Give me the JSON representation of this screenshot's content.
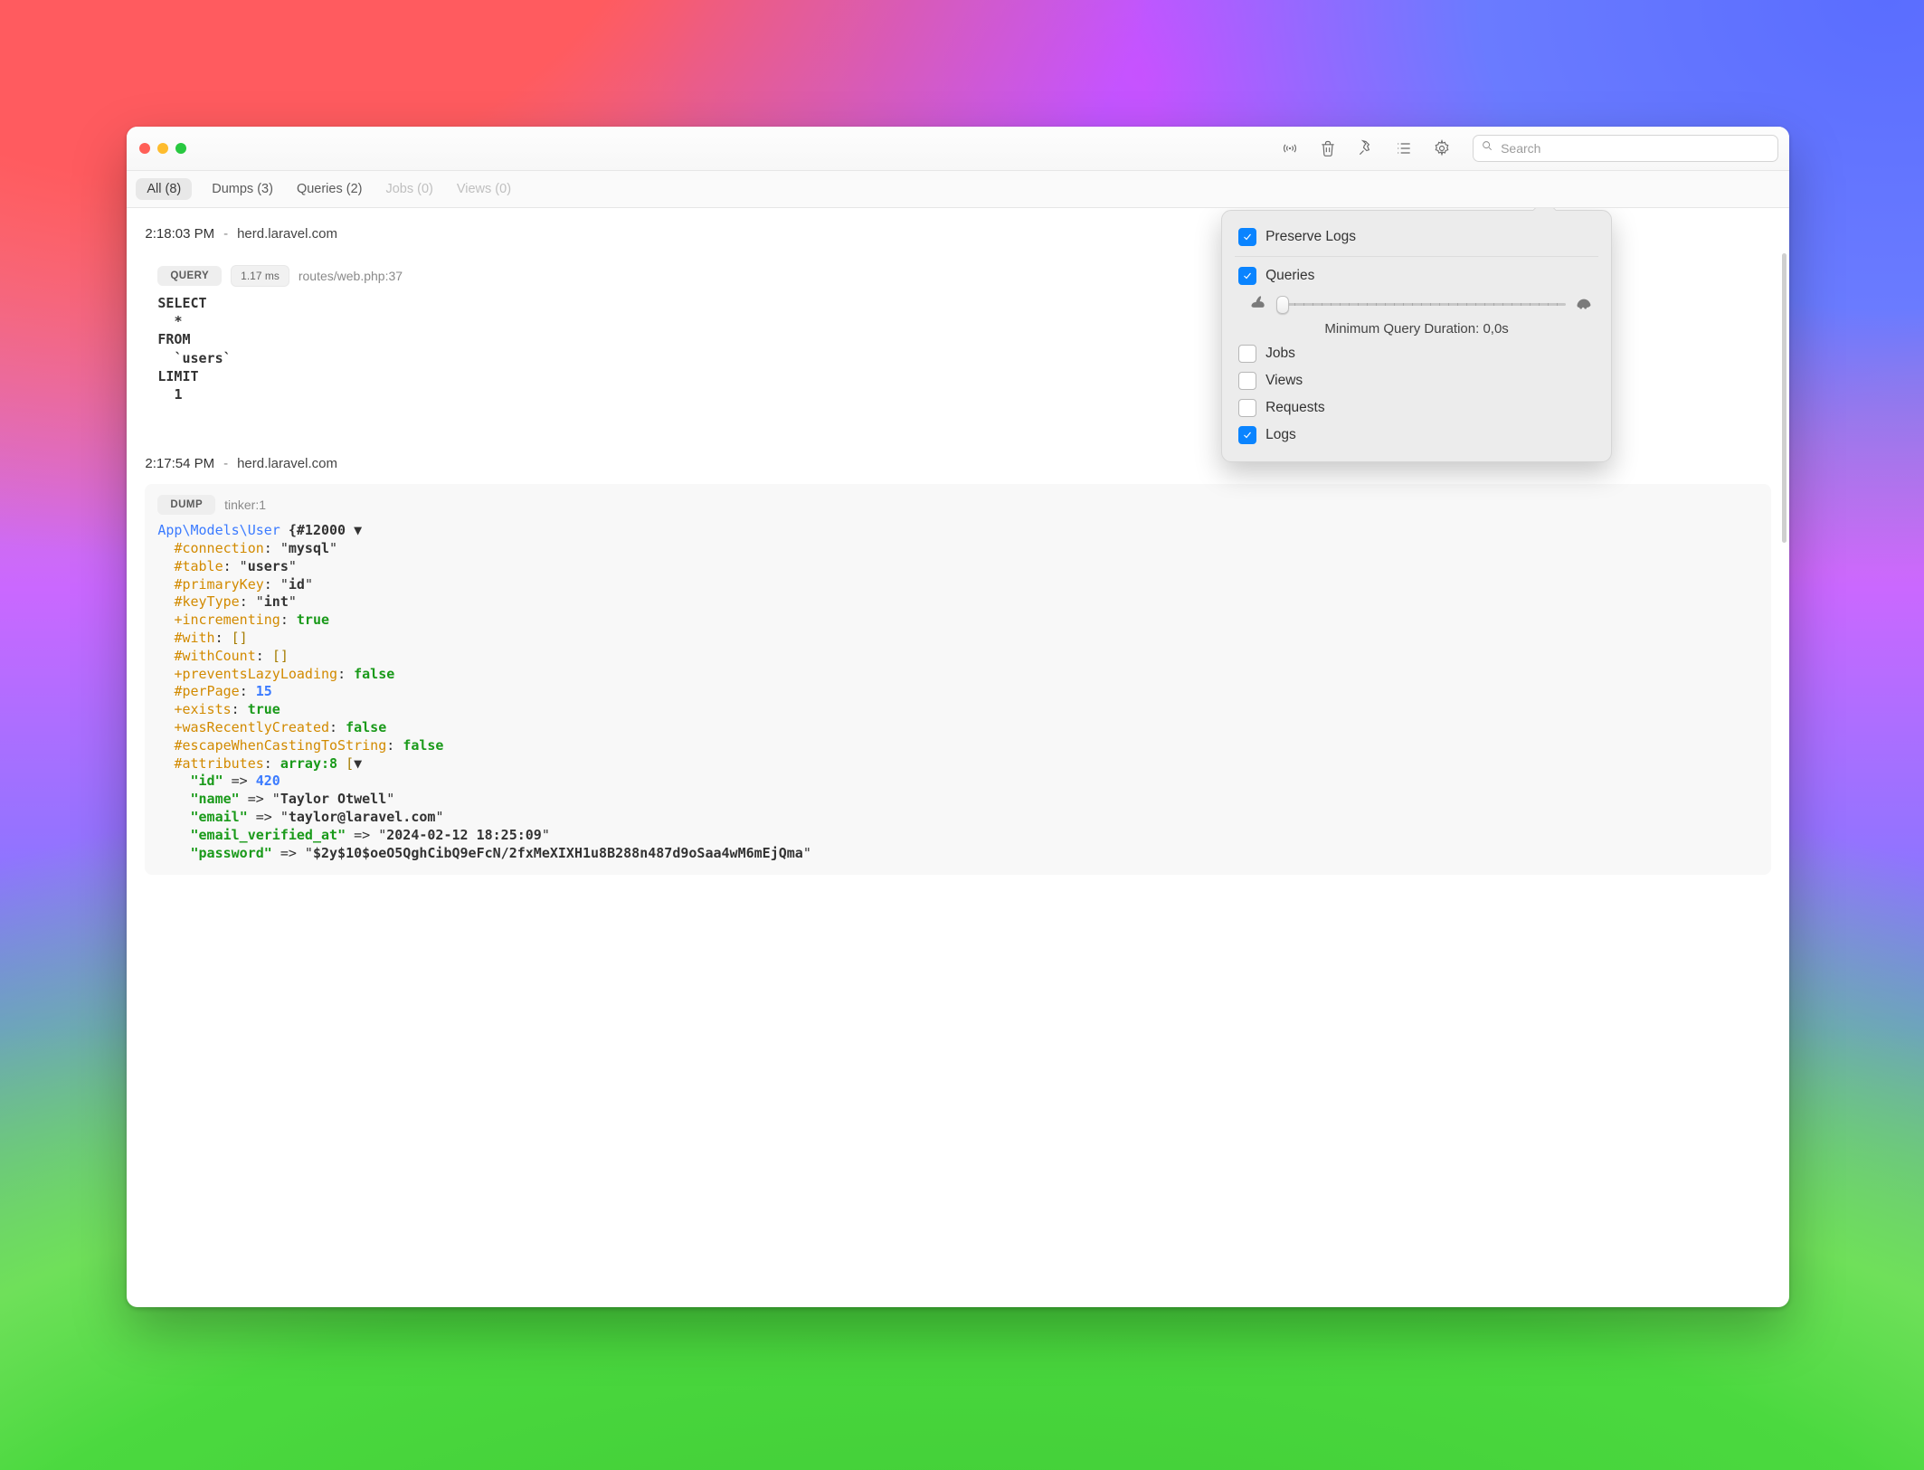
{
  "search": {
    "placeholder": "Search"
  },
  "tabs": {
    "all": {
      "label": "All (8)",
      "active": true,
      "disabled": false
    },
    "dumps": {
      "label": "Dumps (3)",
      "disabled": false
    },
    "queries": {
      "label": "Queries (2)",
      "disabled": false
    },
    "jobs": {
      "label": "Jobs (0)",
      "disabled": true
    },
    "views": {
      "label": "Views (0)",
      "disabled": true
    }
  },
  "popover": {
    "preserve": {
      "label": "Preserve Logs",
      "checked": true
    },
    "queries": {
      "label": "Queries",
      "checked": true
    },
    "slider_caption": "Minimum Query Duration: 0,0s",
    "jobs": {
      "label": "Jobs",
      "checked": false
    },
    "views": {
      "label": "Views",
      "checked": false
    },
    "requests": {
      "label": "Requests",
      "checked": false
    },
    "logs": {
      "label": "Logs",
      "checked": true
    }
  },
  "entries": [
    {
      "time": "2:18:03 PM",
      "host": "herd.laravel.com",
      "kind_badge": "QUERY",
      "duration_pill": "1.17 ms",
      "source": "routes/web.php:37",
      "sql": {
        "l1": "SELECT",
        "l2": "*",
        "l3": "FROM",
        "l4": "`users`",
        "l5": "LIMIT",
        "l6": "1"
      }
    },
    {
      "time": "2:17:54 PM",
      "host": "herd.laravel.com",
      "kind_badge": "DUMP",
      "source": "tinker:1",
      "dump": {
        "class": "App\\Models\\User",
        "object_id": "#12000",
        "props": {
          "connection": {
            "prefix": "#",
            "key": "connection",
            "type": "str",
            "val": "mysql"
          },
          "table": {
            "prefix": "#",
            "key": "table",
            "type": "str",
            "val": "users"
          },
          "primaryKey": {
            "prefix": "#",
            "key": "primaryKey",
            "type": "str",
            "val": "id"
          },
          "keyType": {
            "prefix": "#",
            "key": "keyType",
            "type": "str",
            "val": "int"
          },
          "incrementing": {
            "prefix": "+",
            "key": "incrementing",
            "type": "bool",
            "val": "true"
          },
          "with": {
            "prefix": "#",
            "key": "with",
            "type": "arr_empty"
          },
          "withCount": {
            "prefix": "#",
            "key": "withCount",
            "type": "arr_empty"
          },
          "preventsLazyLoading": {
            "prefix": "+",
            "key": "preventsLazyLoading",
            "type": "bool",
            "val": "false"
          },
          "perPage": {
            "prefix": "#",
            "key": "perPage",
            "type": "num",
            "val": "15"
          },
          "exists": {
            "prefix": "+",
            "key": "exists",
            "type": "bool",
            "val": "true"
          },
          "wasRecentlyCreated": {
            "prefix": "+",
            "key": "wasRecentlyCreated",
            "type": "bool",
            "val": "false"
          },
          "escapeWhenCastingToString": {
            "prefix": "#",
            "key": "escapeWhenCastingToString",
            "type": "bool",
            "val": "false"
          }
        },
        "attributes_label": "attributes",
        "attributes_type": "array:8",
        "attributes": {
          "id": {
            "key": "id",
            "type": "num",
            "val": "420"
          },
          "name": {
            "key": "name",
            "type": "str",
            "val": "Taylor Otwell"
          },
          "email": {
            "key": "email",
            "type": "str",
            "val": "taylor@laravel.com"
          },
          "email_verified_at": {
            "key": "email_verified_at",
            "type": "str",
            "val": "2024-02-12 18:25:09"
          },
          "password": {
            "key": "password",
            "type": "str",
            "val": "$2y$10$oeO5QghCibQ9eFcN/2fxMeXIXH1u8B288n487d9oSaa4wM6mEjQma"
          }
        }
      }
    }
  ]
}
